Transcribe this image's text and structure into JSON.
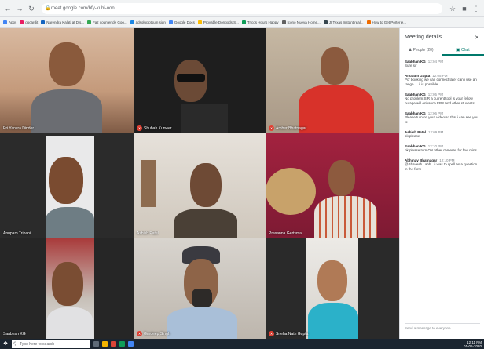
{
  "browser": {
    "url": "meet.google.com/bfy-kuhi-oon",
    "back_icon": "back-arrow-icon",
    "bookmarks": [
      {
        "label": "Apps",
        "color": "#4285f4"
      },
      {
        "label": "gocardit",
        "color": "#e91e63"
      },
      {
        "label": "Narendra Kalati at Dis...",
        "color": "#1565c0"
      },
      {
        "label": "Faz counter de Goo...",
        "color": "#34a853"
      },
      {
        "label": "adsoluciptsum sign",
        "color": "#1e88e5"
      },
      {
        "label": "Google Docs",
        "color": "#4285f4"
      },
      {
        "label": "Provable Dongods S...",
        "color": "#fbbc04"
      },
      {
        "label": "Tricos Hours Happy",
        "color": "#0f9d58"
      },
      {
        "label": "Icono Nueva Home...",
        "color": "#616161"
      },
      {
        "label": "JI Texas Instant real...",
        "color": "#37474f"
      },
      {
        "label": "How to Get Porter e...",
        "color": "#ef6c00"
      }
    ]
  },
  "participants": [
    {
      "name": "Pri Yankra Dinder",
      "muted": false
    },
    {
      "name": "Shubah Kunwer",
      "muted": true
    },
    {
      "name": "Amber Bhatnagar",
      "muted": true
    },
    {
      "name": "Anupam Tripani",
      "muted": false
    },
    {
      "name": "Ashish Patel",
      "muted": false
    },
    {
      "name": "Prasanna Gertsma",
      "muted": false
    },
    {
      "name": "Saabhan KG",
      "muted": false
    },
    {
      "name": "Gurdeep Singh",
      "muted": true
    },
    {
      "name": "Sneha Nath Gupta",
      "muted": true
    }
  ],
  "sidebar": {
    "title": "Meeting details",
    "close_icon": "close-icon",
    "tabs": [
      {
        "label": "People (20)",
        "icon": "people-icon"
      },
      {
        "label": "Chat",
        "icon": "chat-icon"
      }
    ],
    "messages": [
      {
        "sender": "Saabhan KG",
        "time": "12:04 PM",
        "text": "Sure sir"
      },
      {
        "sender": "Anupam Gupta",
        "time": "12:05 PM",
        "text": "Pcr booking we can connect later can i use an range ... it is possible"
      },
      {
        "sender": "Saabhan KG",
        "time": "12:05 PM",
        "text": "No problem.SIR a current tool is your fellow outage will enhance ERS and other students"
      },
      {
        "sender": "Saabhan KG",
        "time": "12:06 PM",
        "text": "Please turn on your video so that i can see you☺"
      },
      {
        "sender": "Ashish Patel",
        "time": "12:09 PM",
        "text": "ok please"
      },
      {
        "sender": "Saabhan KG",
        "time": "12:10 PM",
        "text": "ok please turn ON other cameras for few mins"
      },
      {
        "sender": "Abhinav Bhatnagar",
        "time": "12:10 PM",
        "text": "@Bhavesh ..ahh... i was to spell as a question in the form"
      }
    ],
    "input_placeholder": "Send a message to everyone"
  },
  "taskbar": {
    "search_placeholder": "Type here to search",
    "time": "12:11 PM",
    "date": "01-06-2020",
    "start_icon": "windows-start-icon",
    "search_icon": "search-icon"
  }
}
